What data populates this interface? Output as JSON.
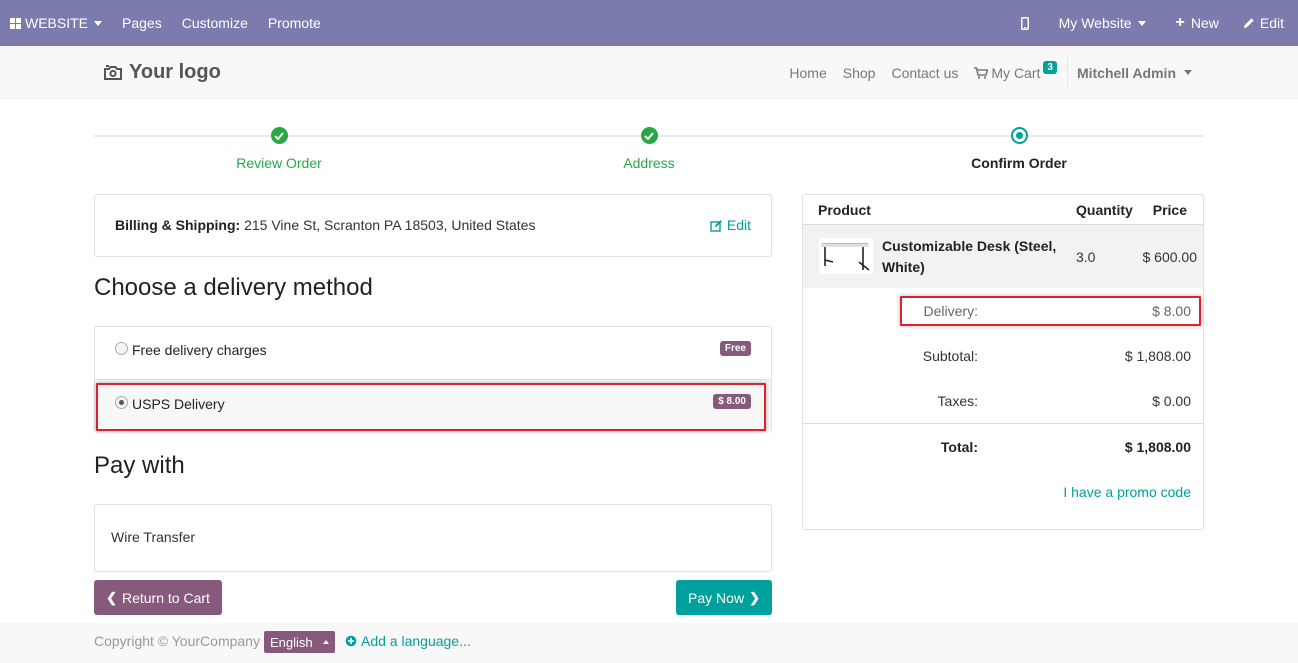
{
  "admin_bar": {
    "website_label": "WEBSITE",
    "pages_label": "Pages",
    "customize_label": "Customize",
    "promote_label": "Promote",
    "my_website_label": "My Website",
    "new_label": "New",
    "edit_label": "Edit"
  },
  "header": {
    "logo_text": "Your logo",
    "nav": {
      "home": "Home",
      "shop": "Shop",
      "contact": "Contact us",
      "cart": "My Cart",
      "cart_count": "3",
      "user": "Mitchell Admin"
    }
  },
  "wizard": {
    "steps": [
      {
        "label": "Review Order",
        "state": "done"
      },
      {
        "label": "Address",
        "state": "done"
      },
      {
        "label": "Confirm Order",
        "state": "current"
      }
    ]
  },
  "billing": {
    "label": "Billing & Shipping:",
    "address": "215 Vine St, Scranton PA 18503, United States",
    "edit_label": "Edit"
  },
  "delivery": {
    "heading": "Choose a delivery method",
    "options": [
      {
        "label": "Free delivery charges",
        "price": "Free",
        "selected": false
      },
      {
        "label": "USPS Delivery",
        "price": "$ 8.00",
        "selected": true
      }
    ]
  },
  "payment": {
    "heading": "Pay with",
    "method": "Wire Transfer"
  },
  "buttons": {
    "return_label": "Return to Cart",
    "pay_label": "Pay Now"
  },
  "summary": {
    "headers": {
      "product": "Product",
      "quantity": "Quantity",
      "price": "Price"
    },
    "item": {
      "name": "Customizable Desk (Steel, White)",
      "quantity": "3.0",
      "price": "$ 600.00"
    },
    "delivery_label": "Delivery:",
    "delivery_value": "$ 8.00",
    "subtotal_label": "Subtotal:",
    "subtotal_value": "$ 1,808.00",
    "taxes_label": "Taxes:",
    "taxes_value": "$ 0.00",
    "total_label": "Total:",
    "total_value": "$ 1,808.00",
    "promo_label": "I have a promo code"
  },
  "footer": {
    "copyright": "Copyright © YourCompany",
    "language": "English",
    "add_language": "Add a language..."
  },
  "colors": {
    "admin_bar": "#7c7bad",
    "primary": "#00a09d",
    "secondary": "#875a7b",
    "success": "#28a745",
    "highlight": "#d9232e"
  }
}
